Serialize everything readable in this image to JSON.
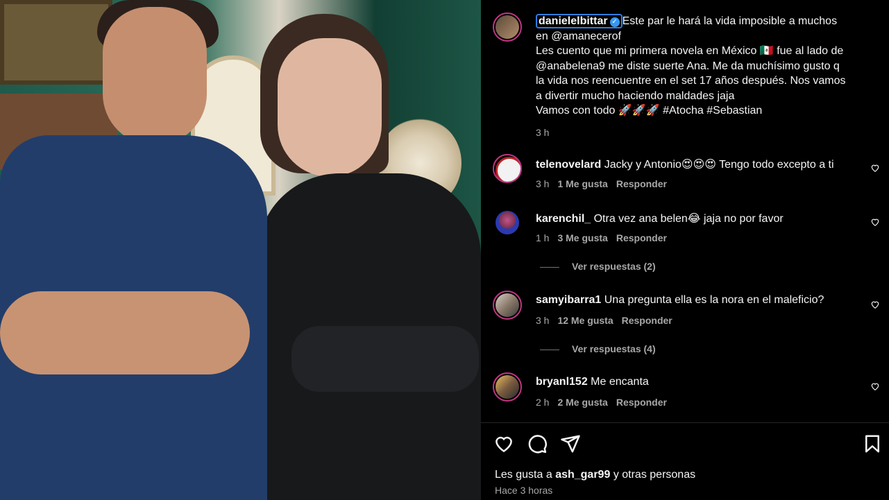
{
  "post": {
    "author": "danielelbittar",
    "caption_lines": [
      "Este par le hará la vida imposible a muchos",
      "en @amanecerof",
      "Les cuento que mi primera novela en México 🇲🇽 fue al lado de",
      "@anabelena9 me diste suerte Ana. Me da muchísimo gusto q",
      "la vida nos reencuentre en el set 17 años después. Nos vamos",
      "a divertir mucho haciendo maldades jaja",
      "Vamos con todo 🚀🚀🚀 #Atocha #Sebastian"
    ],
    "time": "3 h",
    "verified_icon": "verified-badge-icon"
  },
  "comments": [
    {
      "user": "telenovelard",
      "text": "Jacky y Antonio😍😍😍 Tengo todo excepto a ti",
      "time": "3 h",
      "likes": "1 Me gusta",
      "reply": "Responder"
    },
    {
      "user": "karenchil_",
      "text": "Otra vez ana belen😂 jaja no por favor",
      "time": "1 h",
      "likes": "3 Me gusta",
      "reply": "Responder",
      "view_replies": "Ver respuestas (2)"
    },
    {
      "user": "samyibarra1",
      "text": "Una pregunta ella es la nora en el maleficio?",
      "time": "3 h",
      "likes": "12 Me gusta",
      "reply": "Responder",
      "view_replies": "Ver respuestas (4)"
    },
    {
      "user": "bryanl152",
      "text": "Me encanta",
      "time": "2 h",
      "likes": "2 Me gusta",
      "reply": "Responder"
    }
  ],
  "footer": {
    "likes_prefix": "Les gusta a",
    "likes_user": "ash_gar99",
    "likes_suffix": "y otras personas",
    "time": "Hace 3 horas"
  },
  "colors": {
    "background": "#000000",
    "text": "#f5f5f5",
    "muted": "#a8a8a8",
    "ring": "#c13584",
    "verified": "#3897f0"
  }
}
